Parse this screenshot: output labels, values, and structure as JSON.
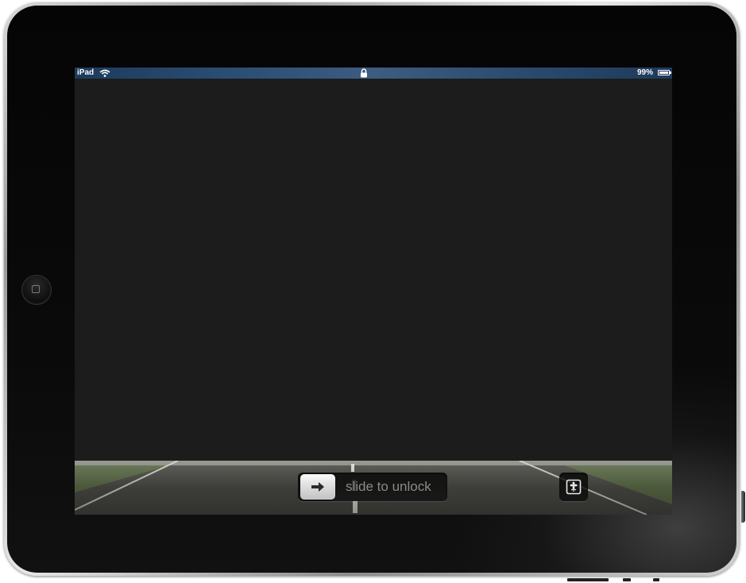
{
  "device": {
    "model": "iPad"
  },
  "status_bar": {
    "carrier": "iPad",
    "wifi_icon": "wifi-icon",
    "lock_icon": "lock-icon",
    "battery_percent": "99%",
    "battery_level": 0.99,
    "battery_icon": "battery-icon"
  },
  "lock_screen": {
    "slider": {
      "label": "slide to unlock",
      "knob_icon": "arrow-right-icon"
    },
    "picture_frame_icon": "picture-frame-icon"
  },
  "colors": {
    "screen_background": "#1c1c1c",
    "status_bar_tint": "#2a4d72",
    "slider_text": "#8a8a8a"
  }
}
